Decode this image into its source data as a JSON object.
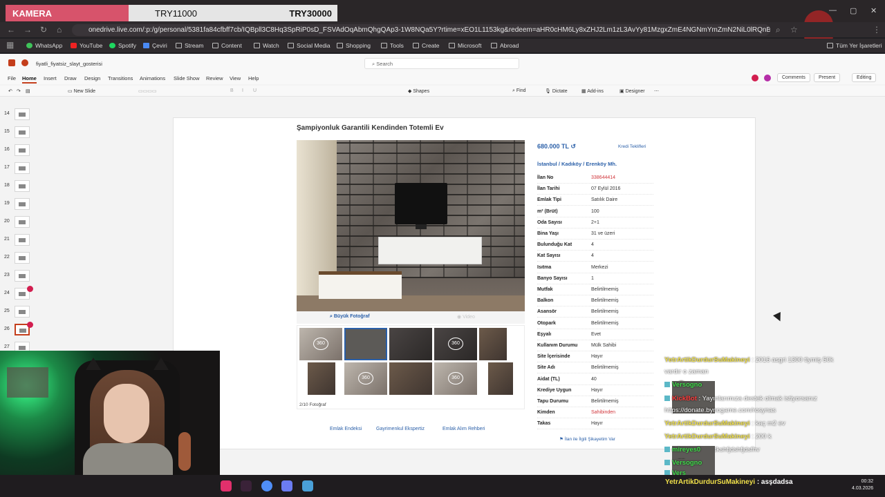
{
  "stream": {
    "camera_label": "KAMERA",
    "goal_a": "TRY11000",
    "goal_b": "TRY30000"
  },
  "browser": {
    "url": "onedrive.live.com/:p:/g/personal/5381fa84cfbff7cb/IQBpll3C8Hq3SpRiP0sD_FSVAdOqAbmQhgQAp3-1W8NQa5Y?rtime=xEO1L1153kg&redeem=aHR0cHM6Ly8xZHJ2Lm1zL3AvYy81MzgxZmE4NGNmYmZmN2NiL0lRQnBsSTNDOEhxM1Nw...",
    "bookmarks": [
      "WhatsApp",
      "YouTube",
      "Spotify",
      "Çeviri",
      "Stream",
      "Content",
      "Watch",
      "Social Media",
      "Shopping",
      "Tools",
      "Create",
      "Microsoft",
      "Abroad"
    ],
    "all_bookmarks": "Tüm Yer İşaretleri"
  },
  "ppt": {
    "doc_title": "fiyatli_fiyatsiz_slayt_gosterisi",
    "search_placeholder": "Search",
    "menus": [
      "File",
      "Home",
      "Insert",
      "Draw",
      "Design",
      "Transitions",
      "Animations",
      "Slide Show",
      "Review",
      "View",
      "Help"
    ],
    "right_buttons": {
      "comments": "Comments",
      "present": "Present",
      "editing": "Editing"
    },
    "ribbon": {
      "new_slide": "New Slide",
      "shapes": "Shapes",
      "find": "Find",
      "dictate": "Dictate",
      "addins": "Add-ins",
      "designer": "Designer"
    },
    "slide_numbers": [
      "14",
      "15",
      "16",
      "17",
      "18",
      "19",
      "20",
      "21",
      "22",
      "23",
      "24",
      "25",
      "26",
      "27"
    ],
    "selected_slide": "26"
  },
  "listing": {
    "title": "Şampiyonluk Garantili Kendinden Totemli Ev",
    "price": "680.000 TL",
    "credit_link": "Kredi Teklifleri",
    "location": "İstanbul  /  Kadıköy  /  Erenköy Mh.",
    "big_photo": "Büyük Fotoğraf",
    "video": "Video",
    "photo_counter": "2/10 Fotoğraf",
    "badge_360": "360",
    "links": [
      "Emlak Endeksi",
      "Gayrimenkul Ekspertiz",
      "Emlak Alım Rehberi"
    ],
    "complaint": "İlan ile İlgili Şikayetim Var",
    "details": [
      {
        "label": "İlan No",
        "value": "338644414"
      },
      {
        "label": "İlan Tarihi",
        "value": "07 Eylül 2016"
      },
      {
        "label": "Emlak Tipi",
        "value": "Satılık Daire"
      },
      {
        "label": "m² (Brüt)",
        "value": "100"
      },
      {
        "label": "Oda Sayısı",
        "value": "2+1"
      },
      {
        "label": "Bina Yaşı",
        "value": "31 ve üzeri"
      },
      {
        "label": "Bulunduğu Kat",
        "value": "4"
      },
      {
        "label": "Kat Sayısı",
        "value": "4"
      },
      {
        "label": "Isıtma",
        "value": "Merkezi"
      },
      {
        "label": "Banyo Sayısı",
        "value": "1"
      },
      {
        "label": "Mutfak",
        "value": "Belirtilmemiş"
      },
      {
        "label": "Balkon",
        "value": "Belirtilmemiş"
      },
      {
        "label": "Asansör",
        "value": "Belirtilmemiş"
      },
      {
        "label": "Otopark",
        "value": "Belirtilmemiş"
      },
      {
        "label": "Eşyalı",
        "value": "Evet"
      },
      {
        "label": "Kullanım Durumu",
        "value": "Mülk Sahibi"
      },
      {
        "label": "Site İçerisinde",
        "value": "Hayır"
      },
      {
        "label": "Site Adı",
        "value": "Belirtilmemiş"
      },
      {
        "label": "Aidat (TL)",
        "value": "40"
      },
      {
        "label": "Krediye Uygun",
        "value": "Hayır"
      },
      {
        "label": "Tapu Durumu",
        "value": "Belirtilmemiş"
      },
      {
        "label": "Kimden",
        "value": "Sahibinden"
      },
      {
        "label": "Takas",
        "value": "Hayır"
      }
    ]
  },
  "chat": [
    {
      "user": "YetrArtikDurdurSuMakineyi",
      "text": ": 2016 asgri 1300 tlymiş 50k",
      "color": "#f0e04a"
    },
    {
      "user": "",
      "text": "vardır o zaman",
      "color": "#f0e04a"
    },
    {
      "user": "Versogno",
      "text": ": 😊",
      "color": "#44e04e"
    },
    {
      "user": "KickBot",
      "text": ": Yayınlarımıza destek olmak istiyorsanız",
      "color": "#ff3d3d"
    },
    {
      "user": "",
      "text": "https://donate.bynogame.com/rosynas",
      "color": "#ff3d3d"
    },
    {
      "user": "YetrArtikDurdurSuMakineyi",
      "text": ": kaç m2 ev",
      "color": "#f0e04a"
    },
    {
      "user": "YetrArtikDurdurSuMakineyi",
      "text": ": 200 k",
      "color": "#f0e04a"
    },
    {
      "user": "mireyes0",
      "text": ": ksjdhfjkkdjhjdkshfjdshfjdsfhv",
      "color": "#44e04e"
    },
    {
      "user": "Versogno",
      "text": ": 💜",
      "color": "#44e04e"
    },
    {
      "user": "Versogno",
      "text": ": 😊",
      "color": "#44e04e"
    }
  ],
  "bottom_chat": {
    "user": "YetrArtikDurdurSuMakineyi",
    "text": " : asşdadsa"
  },
  "clock": {
    "time": "00:32",
    "date": "4.03.2026"
  }
}
